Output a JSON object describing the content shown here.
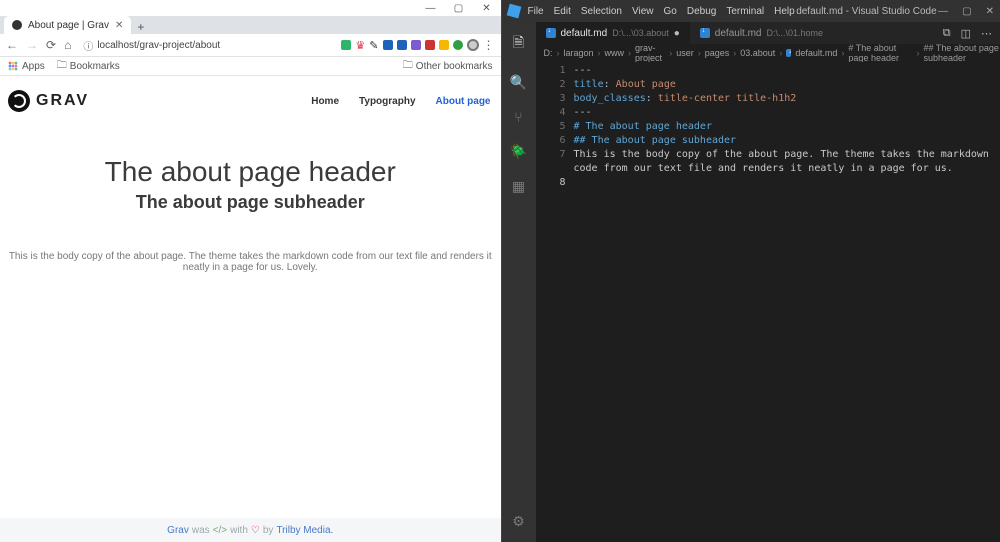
{
  "chrome": {
    "tab_title": "About page | Grav",
    "url": "localhost/grav-project/about",
    "bookmarks_apps": "Apps",
    "bookmarks_label": "Bookmarks",
    "other_bookmarks": "Other bookmarks"
  },
  "site": {
    "brand": "GRAV",
    "nav": {
      "home": "Home",
      "typography": "Typography",
      "about": "About page"
    },
    "h1": "The about page header",
    "h2": "The about page subheader",
    "body": "This is the body copy of the about page. The theme takes the markdown code from our text file and renders it neatly in a page for us. Lovely.",
    "footer_pre": "Grav",
    "footer_mid": "was",
    "footer_with": "with",
    "footer_by": "by",
    "footer_link": "Trilby Media."
  },
  "vscode": {
    "menu": [
      "File",
      "Edit",
      "Selection",
      "View",
      "Go",
      "Debug",
      "Terminal",
      "Help"
    ],
    "window_title": "default.md - Visual Studio Code",
    "tabs": [
      {
        "name": "default.md",
        "path": "D:\\...\\03.about",
        "active": true,
        "dirty": true
      },
      {
        "name": "default.md",
        "path": "D:\\...\\01.home",
        "active": false,
        "dirty": false
      }
    ],
    "breadcrumb": [
      "D:",
      "laragon",
      "www",
      "grav-project",
      "user",
      "pages",
      "03.about",
      "default.md",
      "# The about page header",
      "## The about page subheader"
    ],
    "code": {
      "l1": "---",
      "l2_key": "title",
      "l2_val": "About page",
      "l3_key": "body_classes",
      "l3_val": "title-center title-h1h2",
      "l4": "---",
      "l5": "# The about page header",
      "l6": "## The about page subheader",
      "l7": "This is the body copy of the about page. The theme takes the markdown code from our text file and renders it neatly in a page for us."
    }
  }
}
